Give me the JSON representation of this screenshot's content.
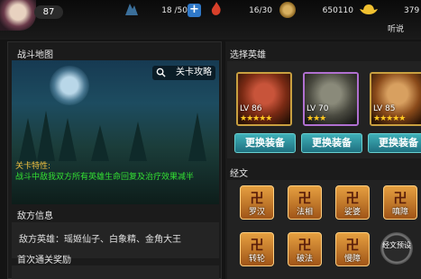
{
  "player": {
    "level": "87"
  },
  "resources": {
    "stamina": "18 /50",
    "energy": "16/30",
    "coins": "650110",
    "gold": "379"
  },
  "top_link": "听说",
  "battle_map": {
    "title": "战斗地图",
    "strategy_button": "关卡攻略",
    "feature_label": "关卡特性:",
    "feature_text": "战斗中敌我双方所有英雄生命回复及治疗效果减半"
  },
  "enemy_info": {
    "title": "敌方信息",
    "text": "敌方英雄：瑶姬仙子、白象精、金角大王"
  },
  "first_clear": {
    "title": "首次通关奖励"
  },
  "hero_select": {
    "title": "选择英雄",
    "heroes": [
      {
        "level": "LV 86",
        "stars": "★★★★★",
        "equip": "更换装备"
      },
      {
        "level": "LV 70",
        "stars": "★★★",
        "equip": "更换装备"
      },
      {
        "level": "LV 85",
        "stars": "★★★★★",
        "equip": "更换装备"
      }
    ]
  },
  "sutras": {
    "title": "经文",
    "items": [
      {
        "glyph": "卍",
        "label": "罗汉"
      },
      {
        "glyph": "卍",
        "label": "法相"
      },
      {
        "glyph": "卍",
        "label": "娑婆"
      },
      {
        "glyph": "卍",
        "label": "嗔障"
      },
      {
        "glyph": "卍",
        "label": "转轮"
      },
      {
        "glyph": "卍",
        "label": "破法"
      },
      {
        "glyph": "卍",
        "label": "慢障"
      }
    ],
    "preset": "经文预设"
  }
}
